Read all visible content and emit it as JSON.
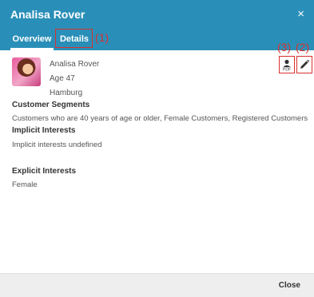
{
  "dialog": {
    "title": "Analisa Rover",
    "close_symbol": "×"
  },
  "tabs": [
    {
      "label": "Overview",
      "active": true
    },
    {
      "label": "Details",
      "active": false
    }
  ],
  "annotations": {
    "one": "(1)",
    "two": "(2)",
    "three": "(3)",
    "color": "#d93030"
  },
  "profile": {
    "name": "Analisa Rover",
    "age": "Age 47",
    "city": "Hamburg"
  },
  "actions": {
    "pdf_icon": "user-pdf-icon",
    "edit_icon": "pencil-icon"
  },
  "sections": {
    "segments_title": "Customer Segments",
    "segments_text": "Customers who are 40 years of age or older, Female Customers, Registered Customers",
    "implicit_title": "Implicit Interests",
    "implicit_text": "Implicit interests undefined",
    "explicit_title": "Explicit Interests",
    "explicit_text": "Female"
  },
  "footer": {
    "close_label": "Close"
  },
  "colors": {
    "header": "#2a8fb8",
    "footer": "#eeeeee"
  }
}
